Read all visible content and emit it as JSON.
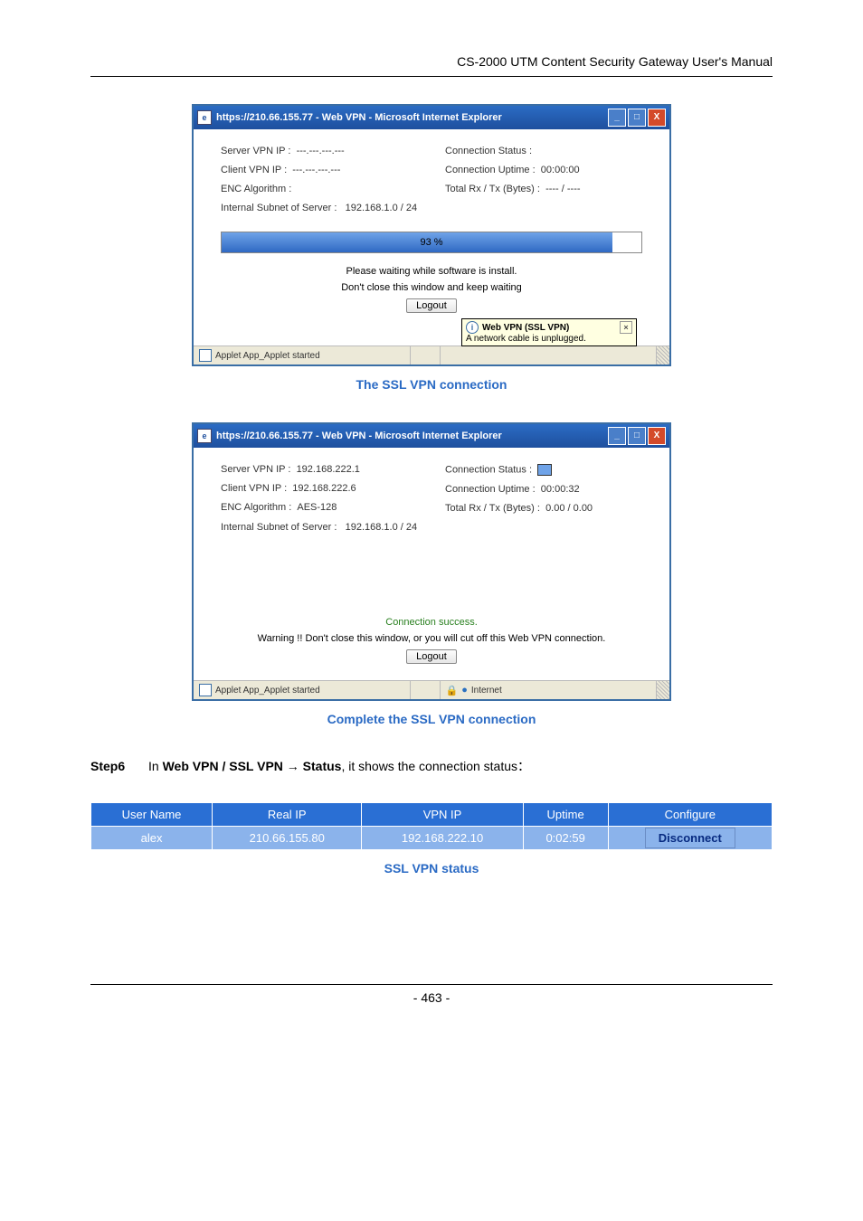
{
  "header": "CS-2000 UTM Content Security Gateway User's Manual",
  "window1": {
    "title": "https://210.66.155.77 - Web VPN - Microsoft Internet Explorer",
    "left": {
      "server_ip_label": "Server VPN IP :",
      "server_ip_value": "---.---.---.---",
      "client_ip_label": "Client VPN IP :",
      "client_ip_value": "---.---.---.---",
      "enc_label": "ENC Algorithm :",
      "enc_value": "",
      "subnet_label": "Internal Subnet of Server :",
      "subnet_value": "192.168.1.0 / 24"
    },
    "right": {
      "conn_status_label": "Connection Status :",
      "conn_status_value": "",
      "uptime_label": "Connection Uptime :",
      "uptime_value": "00:00:00",
      "rxtx_label": "Total Rx / Tx (Bytes) :",
      "rxtx_value": "---- / ----"
    },
    "progress": "93 %",
    "msg1": "Please waiting while software is install.",
    "msg2": "Don't close this window and keep waiting",
    "logout": "Logout",
    "balloon_title": "Web VPN (SSL VPN)",
    "balloon_msg": "A network cable is unplugged.",
    "status_text": "Applet App_Applet started"
  },
  "caption1": "The SSL VPN connection",
  "window2": {
    "title": "https://210.66.155.77 - Web VPN - Microsoft Internet Explorer",
    "left": {
      "server_ip_label": "Server VPN IP :",
      "server_ip_value": "192.168.222.1",
      "client_ip_label": "Client VPN IP :",
      "client_ip_value": "192.168.222.6",
      "enc_label": "ENC Algorithm :",
      "enc_value": "AES-128",
      "subnet_label": "Internal Subnet of Server :",
      "subnet_value": "192.168.1.0 / 24"
    },
    "right": {
      "conn_status_label": "Connection Status :",
      "uptime_label": "Connection Uptime :",
      "uptime_value": "00:00:32",
      "rxtx_label": "Total Rx / Tx (Bytes) :",
      "rxtx_value": "0.00 / 0.00"
    },
    "success": "Connection success.",
    "warning": "Warning !! Don't close this window, or you will cut off this Web VPN connection.",
    "logout": "Logout",
    "status_text": "Applet App_Applet started",
    "status_zone": "Internet"
  },
  "caption2": "Complete the SSL VPN connection",
  "step": {
    "label": "Step6",
    "prefix": "In ",
    "bold": "Web VPN / SSL VPN → Status",
    "suffix": ", it shows the connection status："
  },
  "table": {
    "headers": [
      "User Name",
      "Real IP",
      "VPN IP",
      "Uptime",
      "Configure"
    ],
    "row": {
      "user": "alex",
      "realip": "210.66.155.80",
      "vpnip": "192.168.222.10",
      "uptime": "0:02:59",
      "action": "Disconnect"
    }
  },
  "caption3": "SSL VPN status",
  "page_num": "- 463 -"
}
